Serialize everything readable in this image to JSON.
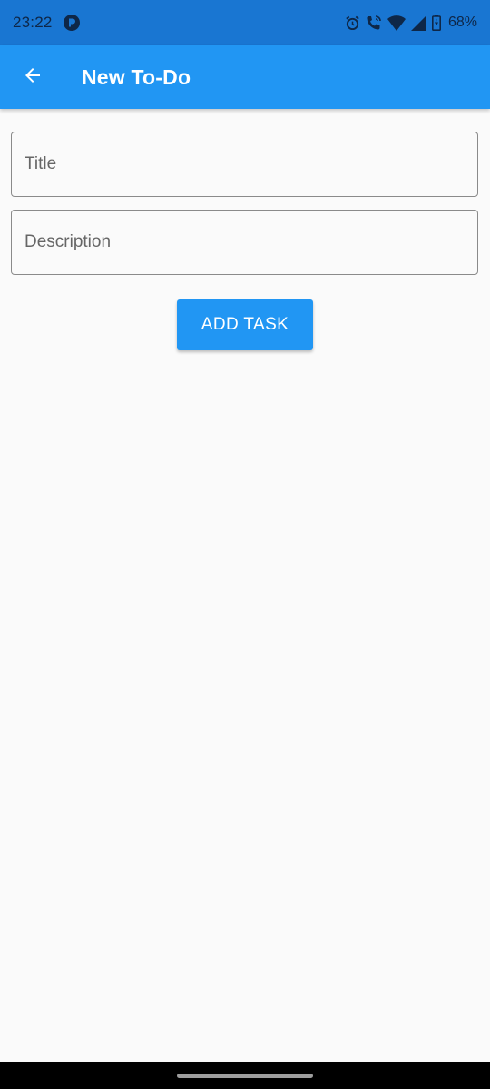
{
  "status_bar": {
    "time": "23:22",
    "battery": "68%",
    "icons": [
      "app-notification-icon",
      "alarm-icon",
      "wifi-call-icon",
      "wifi-icon",
      "signal-icon",
      "battery-icon"
    ]
  },
  "app_bar": {
    "title": "New To-Do",
    "back_icon": "arrow-back-icon"
  },
  "form": {
    "title_placeholder": "Title",
    "title_value": "",
    "description_placeholder": "Description",
    "description_value": "",
    "submit_label": "ADD TASK"
  },
  "colors": {
    "primary": "#2196f3",
    "status_bar": "#1976d2",
    "background": "#fafafa"
  }
}
